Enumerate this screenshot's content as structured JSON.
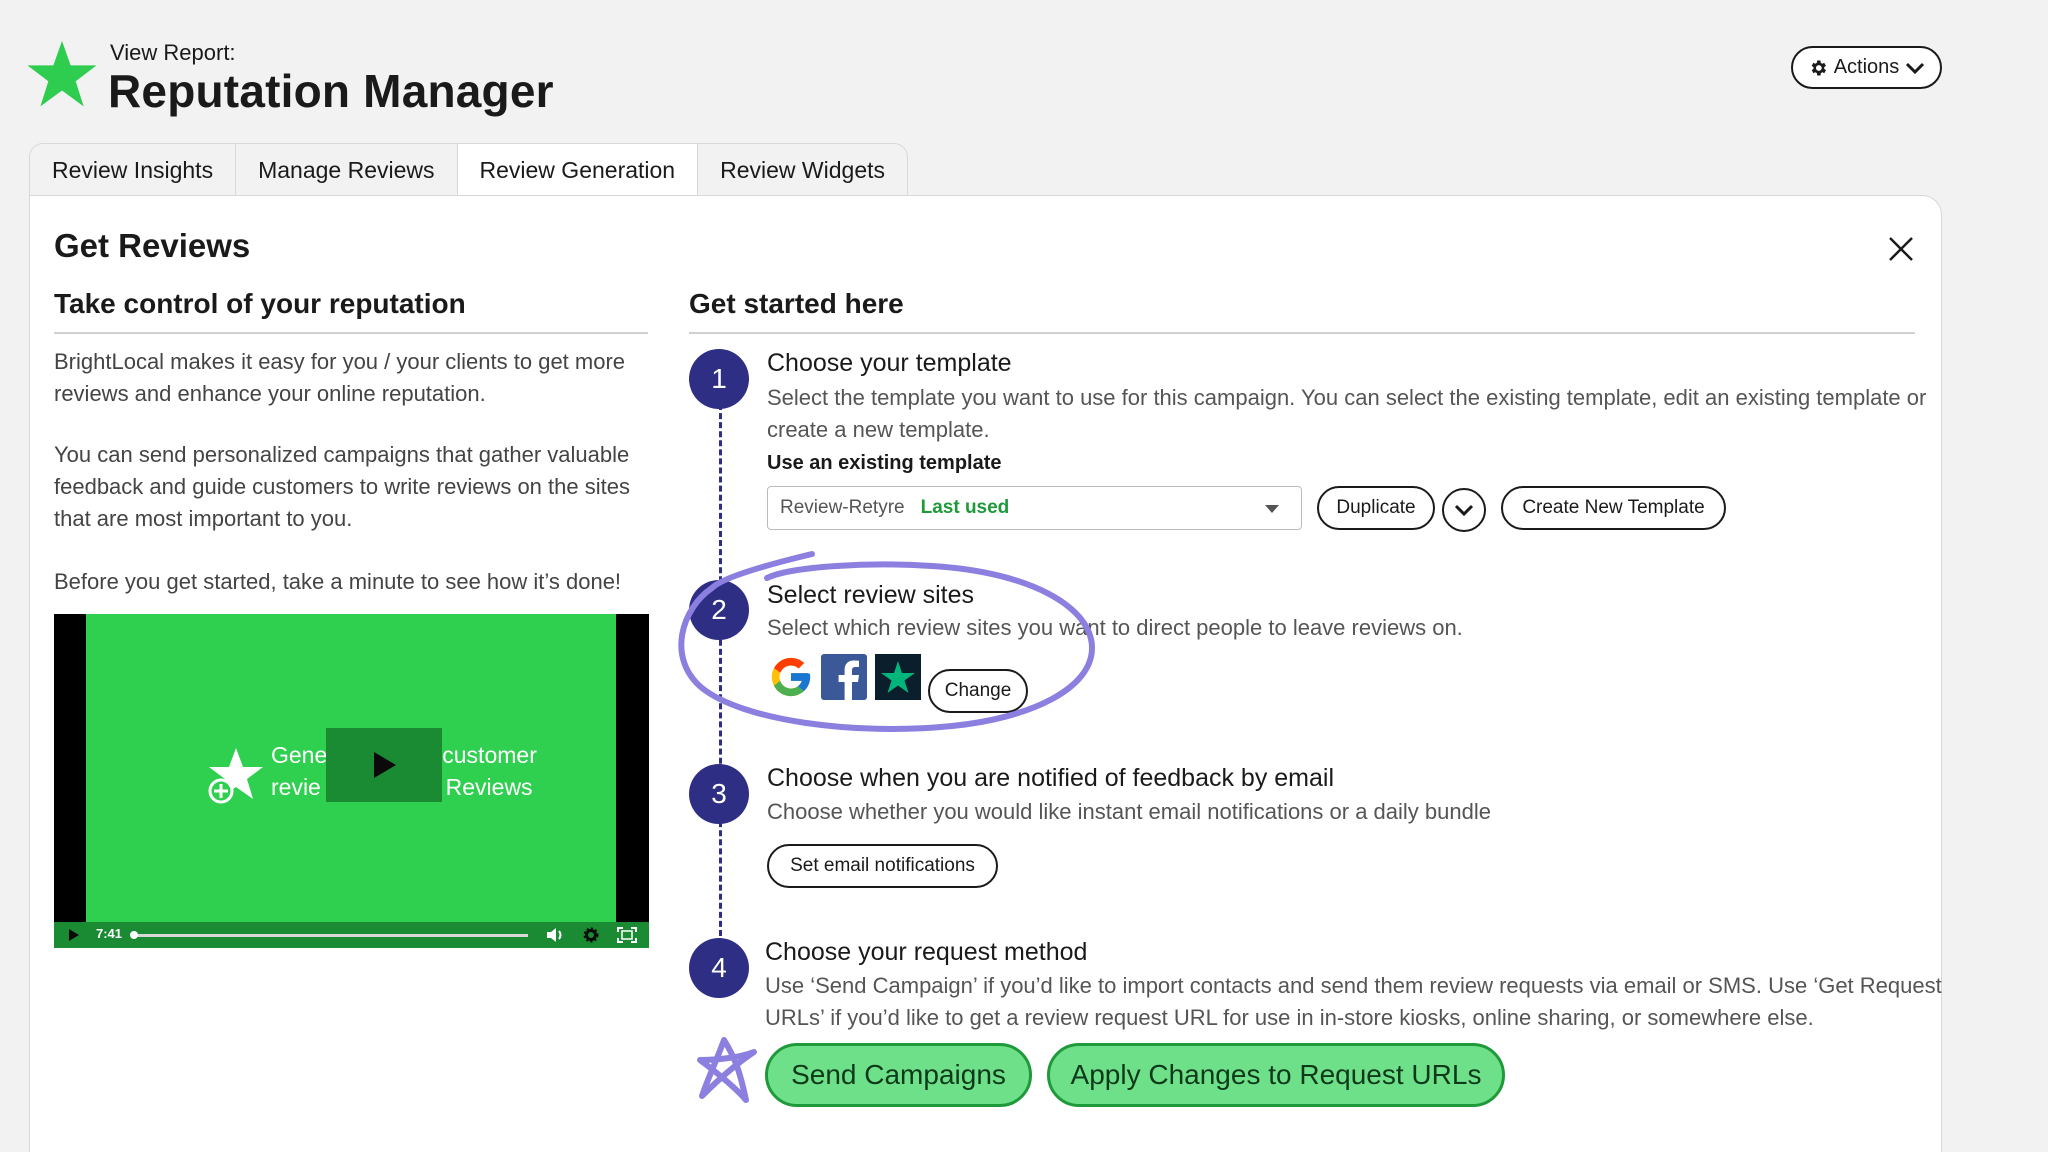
{
  "header": {
    "subtitle": "View Report:",
    "title": "Reputation Manager",
    "actions_label": "Actions",
    "brand_color": "#2ecc4f"
  },
  "tabs": [
    {
      "label": "Review Insights",
      "active": false
    },
    {
      "label": "Manage Reviews",
      "active": false
    },
    {
      "label": "Review Generation",
      "active": true
    },
    {
      "label": "Review Widgets",
      "active": false
    }
  ],
  "card": {
    "title": "Get Reviews"
  },
  "left": {
    "heading": "Take control of your reputation",
    "paragraphs": [
      "BrightLocal makes it easy for you / your clients to get more reviews and enhance your online reputation.",
      "You can send personalized campaigns that gather valuable feedback and guide customers to write reviews on the sites that are most important to you.",
      "Before you get started, take a minute to see how it’s done!"
    ],
    "video": {
      "text_line1": "Gene",
      "text_line1_right": "customer",
      "text_line2": "revie",
      "text_line2_right": "t Reviews",
      "duration": "7:41"
    }
  },
  "right": {
    "heading": "Get started here",
    "steps": [
      {
        "number": "1",
        "title": "Choose your template",
        "description": "Select the template you want to use for this campaign. You can select the existing template, edit an existing template or create a new template.",
        "sub_label": "Use an existing template",
        "select_value": "Review-Retyre",
        "select_badge": "Last used",
        "duplicate_label": "Duplicate",
        "create_label": "Create New Template"
      },
      {
        "number": "2",
        "title": "Select review sites",
        "description": "Select which review sites you want to direct people to leave reviews on.",
        "sites": [
          "google-icon",
          "facebook-icon",
          "trustpilot-icon"
        ],
        "change_label": "Change"
      },
      {
        "number": "3",
        "title": "Choose when you are notified of feedback by email",
        "description": "Choose whether you would like instant email notifications or a daily bundle",
        "button_label": "Set email notifications"
      },
      {
        "number": "4",
        "title": "Choose your request method",
        "description": "Use ‘Send Campaign’ if you’d like to import contacts and send them review requests via email or SMS. Use ‘Get Request URLs’ if you’d like to get a review request URL for use in in-store kiosks, online sharing, or somewhere else.",
        "send_label": "Send Campaigns",
        "apply_label": "Apply Changes to Request URLs"
      }
    ]
  },
  "colors": {
    "step_circle": "#2e2f84",
    "annotation": "#8b7fe0",
    "green_button": "#6fe08a",
    "last_used": "#1e9a3a"
  }
}
